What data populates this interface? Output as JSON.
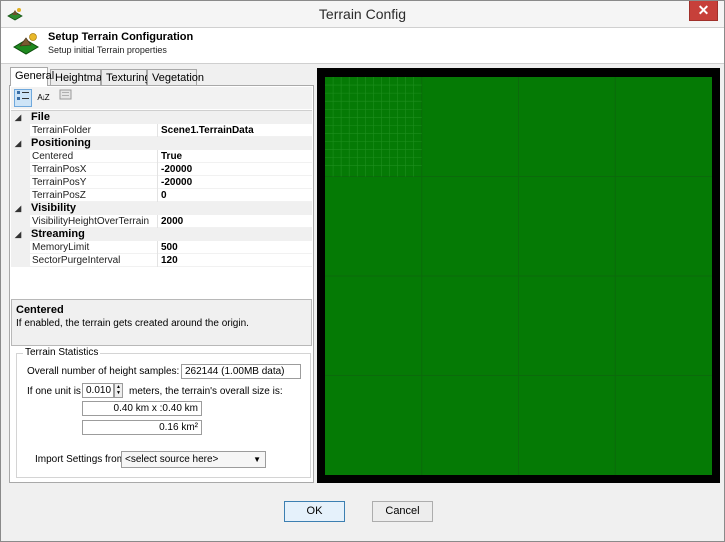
{
  "window": {
    "title": "Terrain Config",
    "close_glyph": "✕"
  },
  "header": {
    "title": "Setup Terrain Configuration",
    "subtitle": "Setup initial Terrain properties",
    "icon": "terrain-icon"
  },
  "tabs": [
    {
      "label": "General",
      "active": true
    },
    {
      "label": "Heightmap",
      "active": false
    },
    {
      "label": "Texturing",
      "active": false
    },
    {
      "label": "Vegetation",
      "active": false
    }
  ],
  "toolbar": {
    "categorized_icon": "categorized-icon",
    "alphabetical_icon": "sort-alphabetical-icon",
    "property_pages_icon": "property-pages-icon",
    "alphabetical_glyph": "A↓Z"
  },
  "property_grid": {
    "categories": [
      {
        "name": "File",
        "properties": [
          {
            "name": "TerrainFolder",
            "value": "Scene1.TerrainData"
          }
        ]
      },
      {
        "name": "Positioning",
        "properties": [
          {
            "name": "Centered",
            "value": "True"
          },
          {
            "name": "TerrainPosX",
            "value": "-20000"
          },
          {
            "name": "TerrainPosY",
            "value": "-20000"
          },
          {
            "name": "TerrainPosZ",
            "value": "0"
          }
        ]
      },
      {
        "name": "Visibility",
        "properties": [
          {
            "name": "VisibilityHeightOverTerrain",
            "value": "2000"
          }
        ]
      },
      {
        "name": "Streaming",
        "properties": [
          {
            "name": "MemoryLimit",
            "value": "500"
          },
          {
            "name": "SectorPurgeInterval",
            "value": "120"
          }
        ]
      }
    ]
  },
  "description": {
    "title": "Centered",
    "text": "If enabled, the terrain gets created around the origin."
  },
  "stats": {
    "legend": "Terrain Statistics",
    "samples_label": "Overall number of height samples:",
    "samples_value": "262144 (1.00MB data)",
    "unit_label": "If one unit is",
    "unit_value": "0.010",
    "unit_suffix": "meters, the terrain's overall size is:",
    "size_value": "0.40 km x :0.40 km",
    "area_value": "0.16 km²",
    "import_label": "Import Settings from:",
    "import_value": "<select source here>"
  },
  "viewport": {
    "terrain_color": "#057a05",
    "background_color": "#000000"
  },
  "buttons": {
    "ok": "OK",
    "cancel": "Cancel"
  }
}
